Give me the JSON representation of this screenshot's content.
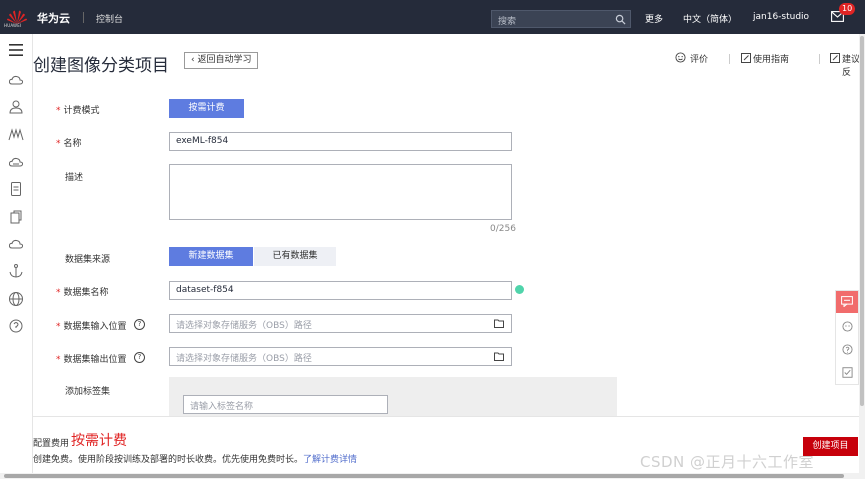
{
  "topbar": {
    "logo_text": "HUAWEI",
    "brand": "华为云",
    "console": "控制台",
    "search_placeholder": "搜索",
    "more": "更多",
    "language": "中文（简体）",
    "user": "jan16-studio",
    "mail_badge": "10",
    "bg_color": "#252b3a"
  },
  "rail": {
    "icons": [
      "cloud-icon",
      "users-icon",
      "model-arts-icon",
      "cloud-service-icon",
      "document-icon",
      "copy-icon",
      "cloud-upload-icon",
      "anchor-icon",
      "globe-icon",
      "more-icon"
    ]
  },
  "header": {
    "title": "创建图像分类项目",
    "back_label": "返回自动学习",
    "rate_label": "评价",
    "guide_label": "使用指南",
    "feedback_label": "建议反"
  },
  "form": {
    "billing_mode_label": "计费模式",
    "billing_mode_value": "按需计费",
    "name_label": "名称",
    "name_value": "exeML-f854",
    "desc_label": "描述",
    "desc_counter": "0/256",
    "dataset_source_label": "数据集来源",
    "dataset_source_options": [
      "新建数据集",
      "已有数据集"
    ],
    "dataset_name_label": "数据集名称",
    "dataset_name_value": "dataset-f854",
    "input_location_label": "数据集输入位置",
    "input_location_placeholder": "请选择对象存储服务（OBS）路径",
    "output_location_label": "数据集输出位置",
    "output_location_placeholder": "请选择对象存储服务（OBS）路径",
    "tag_set_label": "添加标签集",
    "tag_input_placeholder": "请输入标签名称",
    "help_glyph": "?"
  },
  "footer": {
    "fee_label": "配置费用",
    "fee_value": "按需计费",
    "fee_desc": "创建免费。使用阶段按训练及部署的时长收费。优先使用免费时长。",
    "fee_link": "了解计费详情",
    "create_button": "创建项目",
    "watermark": "CSDN @正月十六工作室"
  },
  "colors": {
    "primary": "#5e7ce0",
    "required": "#e02424",
    "create": "#c7000b",
    "success": "#50d4ab"
  }
}
